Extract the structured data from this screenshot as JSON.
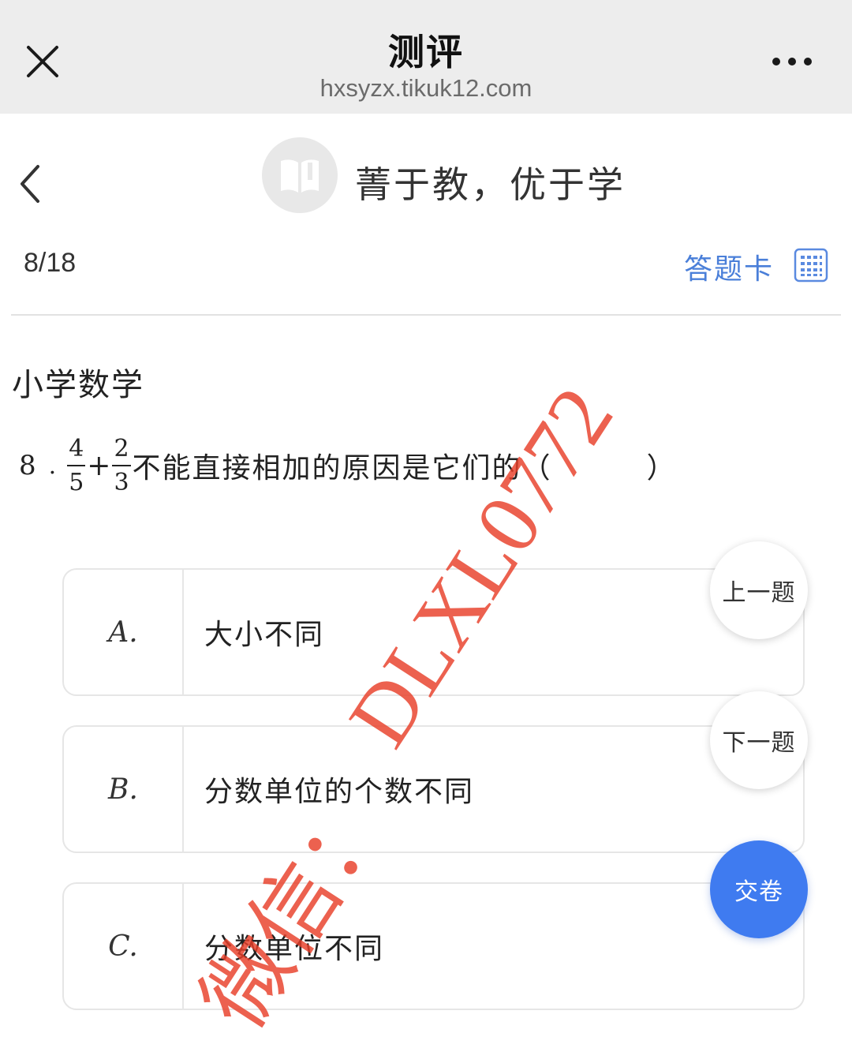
{
  "webview": {
    "title": "测评",
    "url": "hxsyzx.tikuk12.com"
  },
  "header": {
    "slogan": "菁于教，优于学"
  },
  "progress": {
    "text": "8/18"
  },
  "answer_card": {
    "label": "答题卡"
  },
  "question": {
    "subject": "小学数学",
    "number": "8",
    "dot": ".",
    "fraction1": {
      "numerator": "4",
      "denominator": "5"
    },
    "operator": "+",
    "fraction2": {
      "numerator": "2",
      "denominator": "3"
    },
    "text": "不能直接相加的原因是它们的（",
    "close": "）"
  },
  "options": [
    {
      "letter": "A.",
      "text": "大小不同"
    },
    {
      "letter": "B.",
      "text": "分数单位的个数不同"
    },
    {
      "letter": "C.",
      "text": "分数单位不同"
    }
  ],
  "nav": {
    "prev": "上一题",
    "next": "下一题",
    "submit": "交卷"
  },
  "watermark": {
    "label": "微信：",
    "id": "DLXL0772"
  },
  "colors": {
    "accent": "#4a7fd9",
    "submit": "#3f7bf0",
    "watermark": "#e83e28",
    "topbar": "#ededed"
  }
}
